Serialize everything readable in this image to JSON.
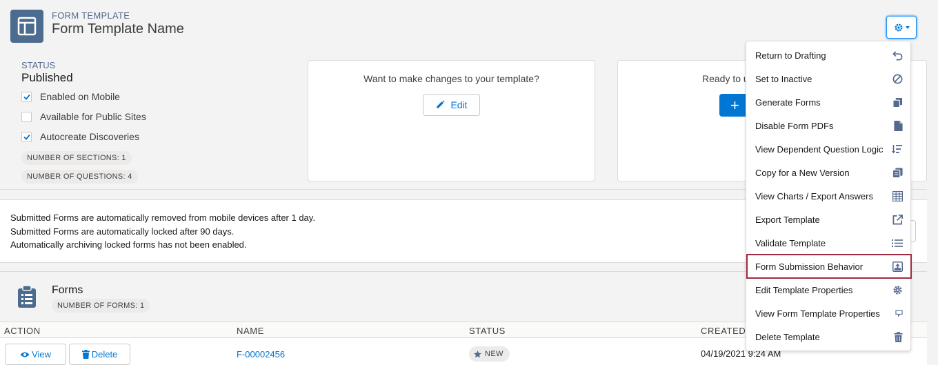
{
  "header": {
    "eyebrow": "FORM TEMPLATE",
    "title": "Form Template Name"
  },
  "status": {
    "label": "STATUS",
    "value": "Published",
    "options": [
      {
        "label": "Enabled on Mobile",
        "checked": true
      },
      {
        "label": "Available for Public Sites",
        "checked": false
      },
      {
        "label": "Autocreate Discoveries",
        "checked": true
      }
    ],
    "sections_pill": "NUMBER OF SECTIONS: 1",
    "questions_pill": "NUMBER OF QUESTIONS: 4"
  },
  "cards": {
    "edit_question": "Want to make changes to your template?",
    "edit_label": "Edit",
    "ready_question": "Ready to u"
  },
  "info": {
    "lines": [
      "Submitted Forms are automatically removed from mobile devices after 1 day.",
      "Submitted Forms are automatically locked after 90 days.",
      "Automatically archiving locked forms has not been enabled."
    ]
  },
  "forms": {
    "title": "Forms",
    "count_pill": "NUMBER OF FORMS: 1",
    "columns": [
      "ACTION",
      "NAME",
      "STATUS",
      "CREATED D"
    ],
    "rows": [
      {
        "view": "View",
        "delete": "Delete",
        "name": "F-00002456",
        "status": "NEW",
        "created": "04/19/2021 9:24 AM"
      }
    ]
  },
  "menu": {
    "items": [
      {
        "label": "Return to Drafting",
        "icon": "undo-icon"
      },
      {
        "label": "Set to Inactive",
        "icon": "ban-icon"
      },
      {
        "label": "Generate Forms",
        "icon": "copy-icon"
      },
      {
        "label": "Disable Form PDFs",
        "icon": "file-icon"
      },
      {
        "label": "View Dependent Question Logic",
        "icon": "sort-lines-icon"
      },
      {
        "label": "Copy for a New Version",
        "icon": "duplicate-icon"
      },
      {
        "label": "View Charts / Export Answers",
        "icon": "table-icon"
      },
      {
        "label": "Export Template",
        "icon": "external-link-icon"
      },
      {
        "label": "Validate Template",
        "icon": "list-icon"
      },
      {
        "label": "Form Submission Behavior",
        "icon": "upload-box-icon",
        "highlighted": true
      },
      {
        "label": "Edit Template Properties",
        "icon": "gear-icon"
      },
      {
        "label": "View Form Template Properties",
        "icon": "comment-icon"
      },
      {
        "label": "Delete Template",
        "icon": "trash-icon"
      }
    ]
  },
  "colors": {
    "brand": "#0176d3",
    "icon_bg": "#4b6b8f",
    "highlight": "#a02a3f"
  }
}
